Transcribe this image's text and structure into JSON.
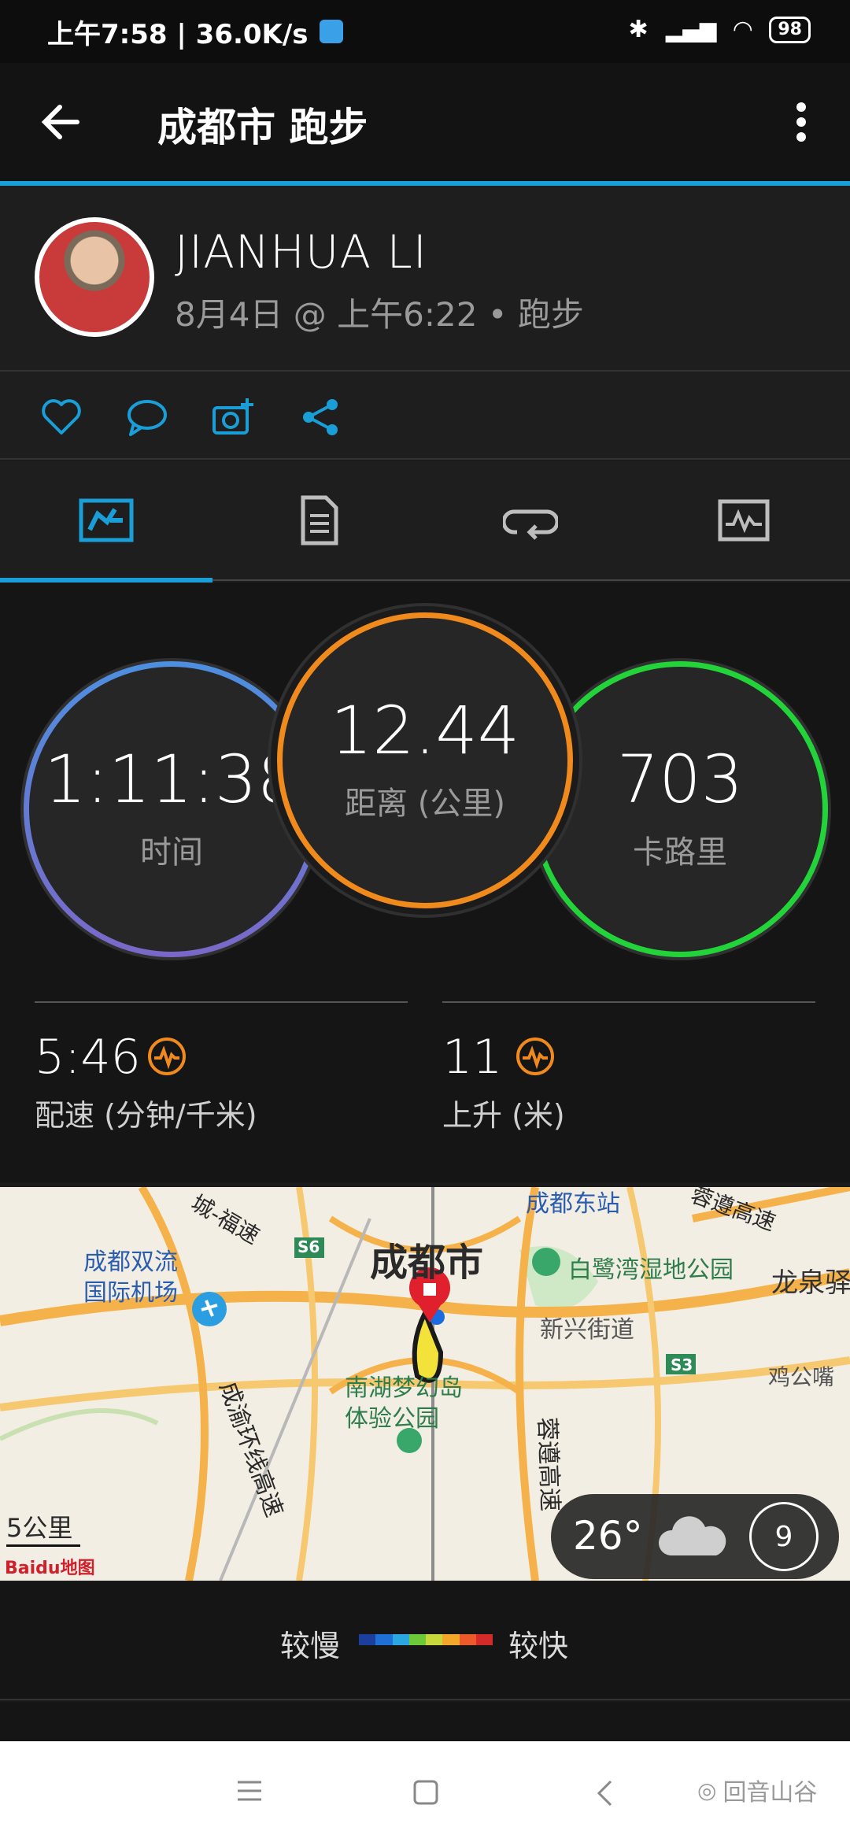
{
  "status": {
    "time": "上午7:58 | 36.0K/s",
    "battery": "98"
  },
  "app": {
    "title": "成都市 跑步"
  },
  "user": {
    "name": "JIANHUA LI",
    "meta": "8月4日 @ 上午6:22 • 跑步"
  },
  "stats": {
    "time": {
      "value": "1:11:38",
      "label": "时间"
    },
    "distance": {
      "value": "12.44",
      "label": "距离 (公里)"
    },
    "calories": {
      "value": "703",
      "label": "卡路里"
    },
    "pace": {
      "value": "5:46",
      "label": "配速 (分钟/千米)"
    },
    "ascent": {
      "value": "11",
      "label": "上升 (米)"
    }
  },
  "map": {
    "labels": {
      "city": "成都市",
      "airport": "成都双流\n国际机场",
      "park1": "白鹭湾湿地公园",
      "street": "新兴街道",
      "park2": "南湖梦幻岛\n体验公园",
      "east_station": "成都东站",
      "longquan": "龙泉驿",
      "highway_top": "城-福速",
      "highway_right": "蓉遵高速",
      "ring": "成渝环线高速",
      "rongzun": "蓉遵高速",
      "s6": "S6",
      "s3": "S3",
      "right_bottom": "鸡公嘴"
    },
    "scale": "5公里",
    "brand": "Baidu地图"
  },
  "weather": {
    "temp": "26°",
    "wind": "9"
  },
  "legend": {
    "slow": "较慢",
    "fast": "较快",
    "colors": [
      "#1c3f9e",
      "#1e6fd6",
      "#2aa6e0",
      "#6bc93a",
      "#c8d83a",
      "#f2a62a",
      "#ec5a2a",
      "#d42a2a"
    ]
  },
  "watermark": {
    "text": "回音山谷"
  },
  "colors": {
    "accent": "#1a9ed8",
    "time_ring": "#4d8fe0",
    "distance_ring": "#f08a1c",
    "calorie_ring": "#22d43a",
    "metric_icon": "#f08a1c"
  }
}
